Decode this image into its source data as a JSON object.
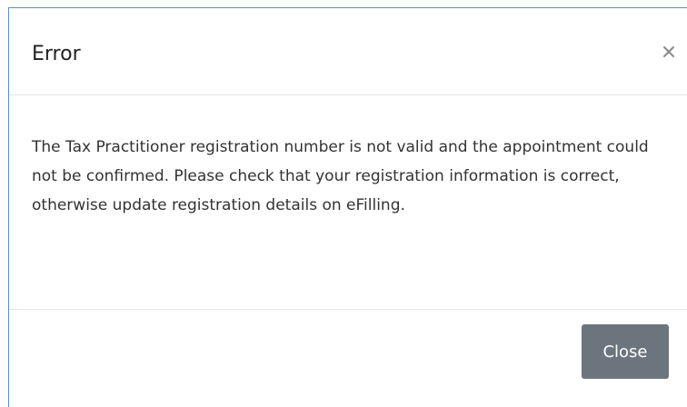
{
  "dialog": {
    "title": "Error",
    "close_icon": "close-icon",
    "message": "The Tax Practitioner registration number is not valid and the appointment could not be confirmed. Please check that your registration information is correct, otherwise update registration details on eFilling.",
    "close_button_label": "Close"
  },
  "colors": {
    "border_accent": "#5a8fbf",
    "close_button_bg": "#6c757d",
    "close_button_text": "#ffffff",
    "divider": "#e5e5e5"
  }
}
